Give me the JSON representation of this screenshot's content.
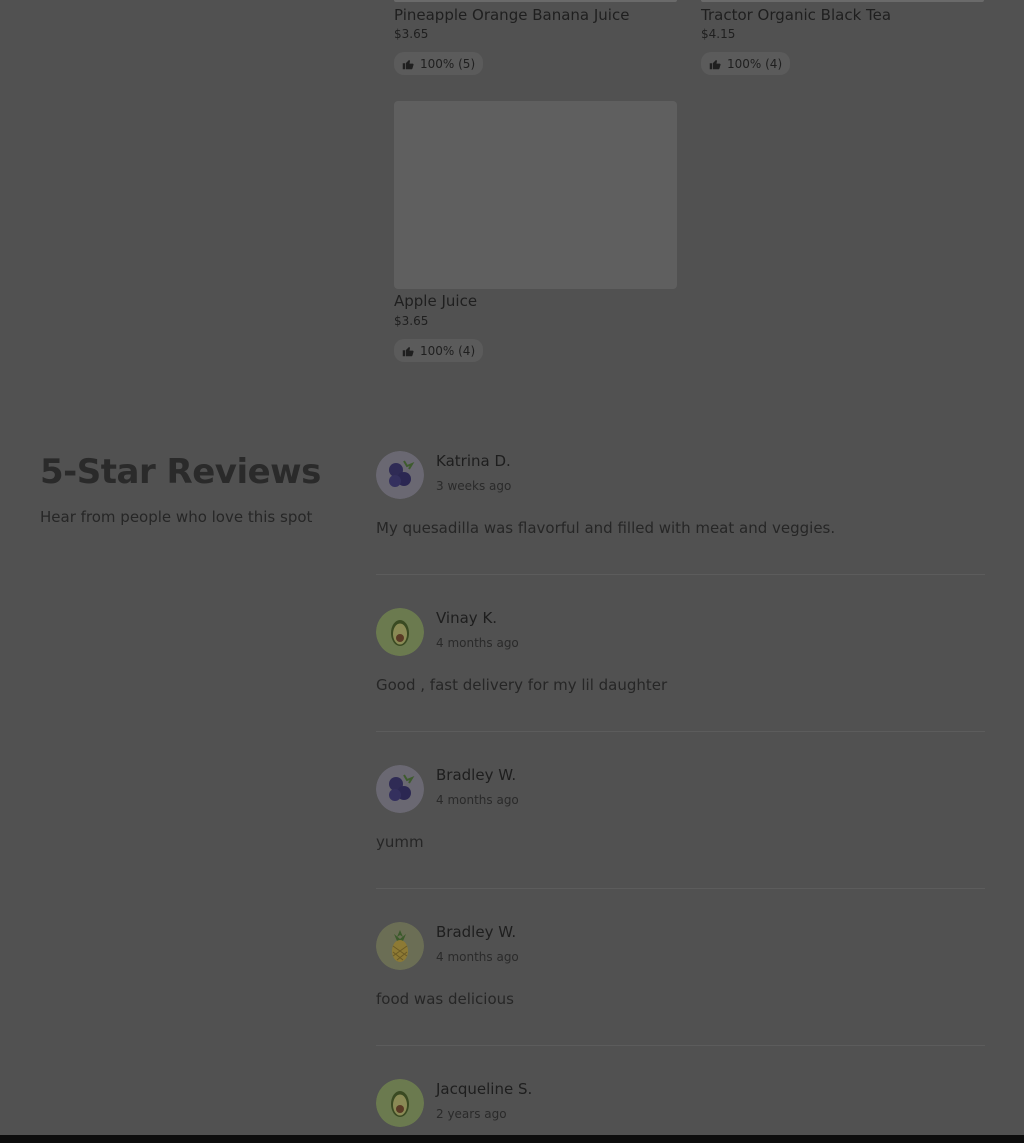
{
  "products": [
    {
      "name": "Pineapple Orange Banana Juice",
      "price": "$3.65",
      "rating": "100% (5)"
    },
    {
      "name": "Tractor Organic Black Tea",
      "price": "$4.15",
      "rating": "100% (4)"
    },
    {
      "name": "Apple Juice",
      "price": "$3.65",
      "rating": "100% (4)"
    }
  ],
  "reviews_section": {
    "title": "5-Star Reviews",
    "subtitle": "Hear from people who love this spot"
  },
  "reviews": [
    {
      "author": "Katrina D.",
      "time": "3 weeks ago",
      "text": "My quesadilla was flavorful and filled with meat and veggies.",
      "avatar": "blueberry-icon"
    },
    {
      "author": "Vinay K.",
      "time": "4 months ago",
      "text": "Good , fast delivery for my lil daughter",
      "avatar": "avocado-icon"
    },
    {
      "author": "Bradley W.",
      "time": "4 months ago",
      "text": "yumm",
      "avatar": "blueberry-icon"
    },
    {
      "author": "Bradley W.",
      "time": "4 months ago",
      "text": "food was delicious",
      "avatar": "pineapple-icon"
    },
    {
      "author": "Jacqueline S.",
      "time": "2 years ago",
      "text": "",
      "avatar": "avocado-icon"
    }
  ],
  "colors": {
    "overlay_bg": "#515151",
    "avatar_purple": "#6c6a75",
    "avatar_green": "#6e7c55"
  }
}
